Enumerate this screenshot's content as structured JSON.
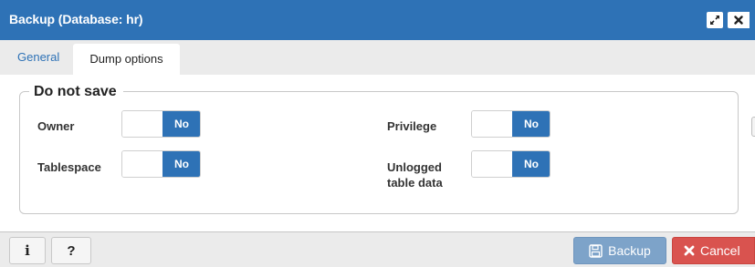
{
  "dialog": {
    "title": "Backup (Database: hr)",
    "maximize_icon": "expand-arrows-icon",
    "close_icon": "close-icon"
  },
  "tabs": [
    {
      "label": "General",
      "active": false
    },
    {
      "label": "Dump options",
      "active": true
    }
  ],
  "section": {
    "legend": "Do not save",
    "fields": [
      {
        "label": "Owner",
        "value": "No"
      },
      {
        "label": "Privilege",
        "value": "No"
      },
      {
        "label": "Tablespace",
        "value": "No"
      },
      {
        "label_line1": "Unlogged",
        "label_line2": "table data",
        "value": "No"
      }
    ]
  },
  "footer": {
    "info_glyph": "i",
    "help_glyph": "?",
    "backup_label": "Backup",
    "cancel_label": "Cancel"
  },
  "colors": {
    "titlebar": "#2e72b6",
    "toggle_on": "#2e72b6",
    "backup_button": "#7da3c9",
    "cancel_button": "#d9534f",
    "active_tab_text": "#222222",
    "inactive_tab_text": "#2e72b6"
  }
}
